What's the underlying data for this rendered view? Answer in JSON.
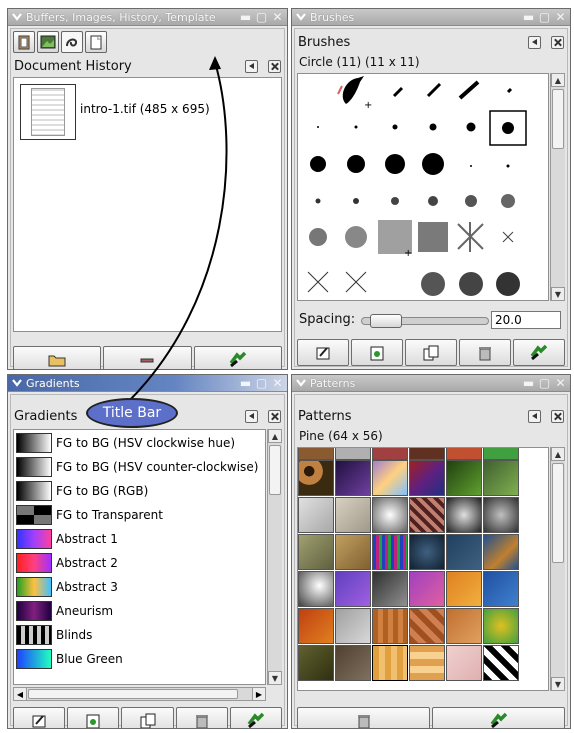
{
  "windows": {
    "buffers": {
      "title": "Buffers, Images, History, Template"
    },
    "brushes": {
      "title": "Brushes"
    },
    "gradients": {
      "title": "Gradients"
    },
    "patterns": {
      "title": "Patterns"
    }
  },
  "history": {
    "header": "Document History",
    "item": "intro-1.tif (485 x 695)"
  },
  "brushes": {
    "header": "Brushes",
    "selected": "Circle (11) (11 x 11)",
    "spacing_label": "Spacing:",
    "spacing_value": "20.0"
  },
  "gradients": {
    "header": "Gradients",
    "items": [
      {
        "name": "FG to BG (HSV clockwise hue)",
        "swatch": "linear-gradient(90deg,#000,#fff)"
      },
      {
        "name": "FG to BG (HSV counter-clockwise)",
        "swatch": "linear-gradient(90deg,#000,#fff)"
      },
      {
        "name": "FG to BG (RGB)",
        "swatch": "linear-gradient(90deg,#000,#fff)"
      },
      {
        "name": "FG to Transparent",
        "swatch": "repeating-conic-gradient(#000 0 25%,#777 0 50%)"
      },
      {
        "name": "Abstract 1",
        "swatch": "linear-gradient(90deg,#3333ff,#a040ff,#ff40a0)"
      },
      {
        "name": "Abstract 2",
        "swatch": "linear-gradient(90deg,#ff2020,#ff4080,#a030ff)"
      },
      {
        "name": "Abstract 3",
        "swatch": "linear-gradient(90deg,#20a020,#ffc040,#40c0ff)"
      },
      {
        "name": "Aneurism",
        "swatch": "linear-gradient(90deg,#200040,#802080,#200040)"
      },
      {
        "name": "Blinds",
        "swatch": "repeating-linear-gradient(90deg,#000 0 4px,#ccc 4px 8px)"
      },
      {
        "name": "Blue Green",
        "swatch": "linear-gradient(90deg,#2040ff,#20ffc0)"
      }
    ]
  },
  "patterns": {
    "header": "Patterns",
    "selected": "Pine (64 x 56)"
  },
  "callout": {
    "text": "Title Bar"
  }
}
